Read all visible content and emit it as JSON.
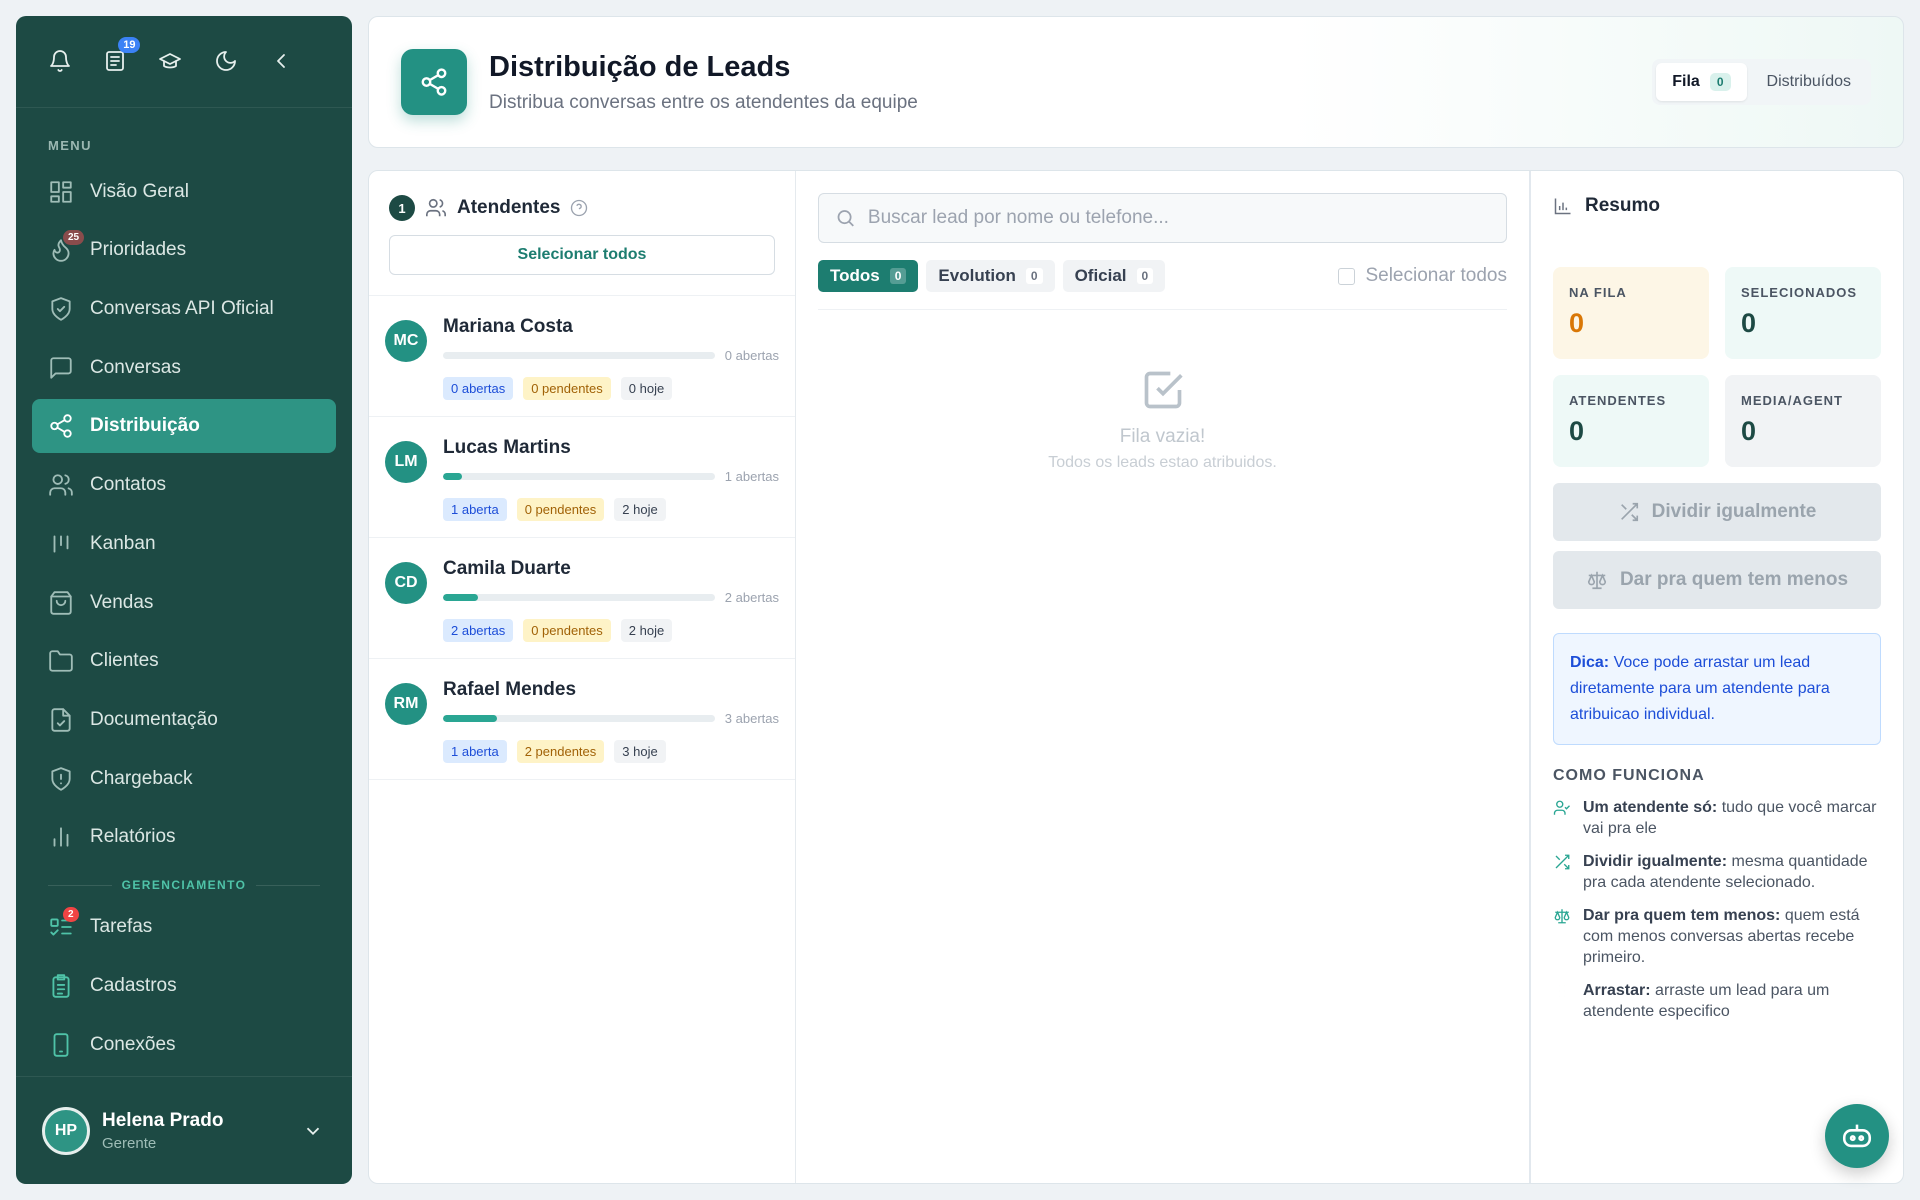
{
  "topbar": {
    "news_badge": "19"
  },
  "sidebar": {
    "menu_label": "MENU",
    "items": [
      {
        "label": "Visão Geral"
      },
      {
        "label": "Prioridades",
        "badge": "25"
      },
      {
        "label": "Conversas API Oficial"
      },
      {
        "label": "Conversas"
      },
      {
        "label": "Distribuição"
      },
      {
        "label": "Contatos"
      },
      {
        "label": "Kanban"
      },
      {
        "label": "Vendas"
      },
      {
        "label": "Clientes"
      },
      {
        "label": "Documentação"
      },
      {
        "label": "Chargeback"
      },
      {
        "label": "Relatórios"
      }
    ],
    "management_label": "GERENCIAMENTO",
    "management_items": [
      {
        "label": "Tarefas",
        "badge": "2"
      },
      {
        "label": "Cadastros"
      },
      {
        "label": "Conexões"
      }
    ],
    "user": {
      "initials": "HP",
      "name": "Helena Prado",
      "role": "Gerente"
    }
  },
  "header": {
    "title": "Distribuição de Leads",
    "subtitle": "Distribua conversas entre os atendentes da equipe",
    "tabs": [
      {
        "label": "Fila",
        "count": "0"
      },
      {
        "label": "Distribuídos"
      }
    ]
  },
  "agents": {
    "step": "1",
    "title": "Atendentes",
    "select_all": "Selecionar todos",
    "list": [
      {
        "initials": "MC",
        "name": "Mariana Costa",
        "progress": 0,
        "bar_label": "0 abertas",
        "open": "0 abertas",
        "pending": "0 pendentes",
        "today": "0 hoje"
      },
      {
        "initials": "LM",
        "name": "Lucas Martins",
        "progress": 0.07,
        "bar_label": "1 abertas",
        "open": "1 aberta",
        "pending": "0 pendentes",
        "today": "2 hoje"
      },
      {
        "initials": "CD",
        "name": "Camila Duarte",
        "progress": 0.13,
        "bar_label": "2 abertas",
        "open": "2 abertas",
        "pending": "0 pendentes",
        "today": "2 hoje"
      },
      {
        "initials": "RM",
        "name": "Rafael Mendes",
        "progress": 0.2,
        "bar_label": "3 abertas",
        "open": "1 aberta",
        "pending": "2 pendentes",
        "today": "3 hoje"
      }
    ]
  },
  "leads": {
    "search_placeholder": "Buscar lead por nome ou telefone...",
    "filters": [
      {
        "label": "Todos",
        "count": "0"
      },
      {
        "label": "Evolution",
        "count": "0"
      },
      {
        "label": "Oficial",
        "count": "0"
      }
    ],
    "select_all": "Selecionar todos",
    "empty_title": "Fila vazia!",
    "empty_sub": "Todos os leads estao atribuidos."
  },
  "summary": {
    "title": "Resumo",
    "stats": [
      {
        "label": "NA FILA",
        "value": "0"
      },
      {
        "label": "SELECIONADOS",
        "value": "0"
      },
      {
        "label": "ATENDENTES",
        "value": "0"
      },
      {
        "label": "MEDIA/AGENT",
        "value": "0"
      }
    ],
    "btn_split": "Dividir igualmente",
    "btn_least": "Dar pra quem tem menos",
    "tip_bold": "Dica:",
    "tip_text": "Voce pode arrastar um lead diretamente para um atendente para atribuicao individual.",
    "how_title": "COMO FUNCIONA",
    "how": [
      {
        "bold": "Um atendente só:",
        "text": "tudo que você marcar vai pra ele"
      },
      {
        "bold": "Dividir igualmente:",
        "text": "mesma quantidade pra cada atendente selecionado."
      },
      {
        "bold": "Dar pra quem tem menos:",
        "text": "quem está com menos conversas abertas recebe primeiro."
      },
      {
        "bold": "Arrastar:",
        "text": "arraste um lead para um atendente especifico"
      }
    ]
  }
}
